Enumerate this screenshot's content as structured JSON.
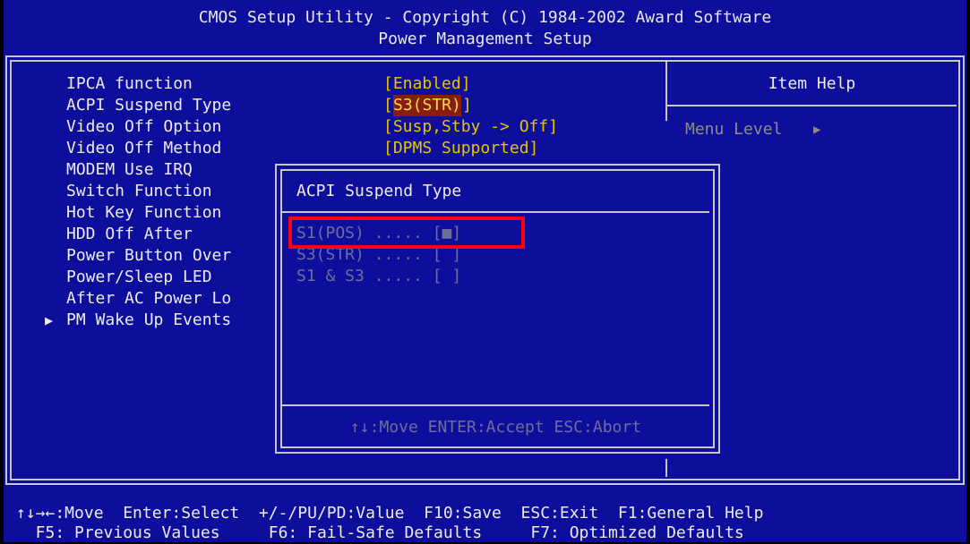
{
  "header": {
    "title": "CMOS Setup Utility - Copyright (C) 1984-2002 Award Software",
    "subtitle": "Power Management Setup"
  },
  "settings": {
    "labels": [
      "IPCA function",
      "ACPI Suspend Type",
      "Video Off Option",
      "Video Off Method",
      "MODEM Use IRQ",
      "Switch Function",
      "Hot Key Function",
      "HDD Off After",
      "Power Button Over",
      "Power/Sleep LED",
      "After AC Power Lo",
      "PM Wake Up Events"
    ],
    "values": {
      "ipca": "[Enabled]",
      "acpi_open": "[",
      "acpi_value": "S3(STR)",
      "acpi_close": "]",
      "video_off_option": "[Susp,Stby -> Off]",
      "video_off_method": "[DPMS Supported]"
    },
    "submenu_arrow": "▶"
  },
  "help": {
    "title": "Item Help",
    "menu_level_label": "Menu Level",
    "menu_level_arrow": "▶"
  },
  "popup": {
    "title": "ACPI Suspend Type",
    "options": [
      "S1(POS) ..... [■]",
      "S3(STR) ..... [ ]",
      "S1 & S3 ..... [ ]"
    ],
    "footer": "↑↓:Move ENTER:Accept ESC:Abort"
  },
  "footer": {
    "row1": "↑↓→←:Move  Enter:Select  +/-/PU/PD:Value  F10:Save  ESC:Exit  F1:General Help",
    "row2": "  F5: Previous Values     F6: Fail-Safe Defaults     F7: Optimized Defaults"
  },
  "colors": {
    "background": "#0e0e9c",
    "highlight_bg": "#8a1c12",
    "highlight_fg": "#f0e040",
    "value_yellow": "#e6c400",
    "annotation_red": "#ff0010"
  }
}
